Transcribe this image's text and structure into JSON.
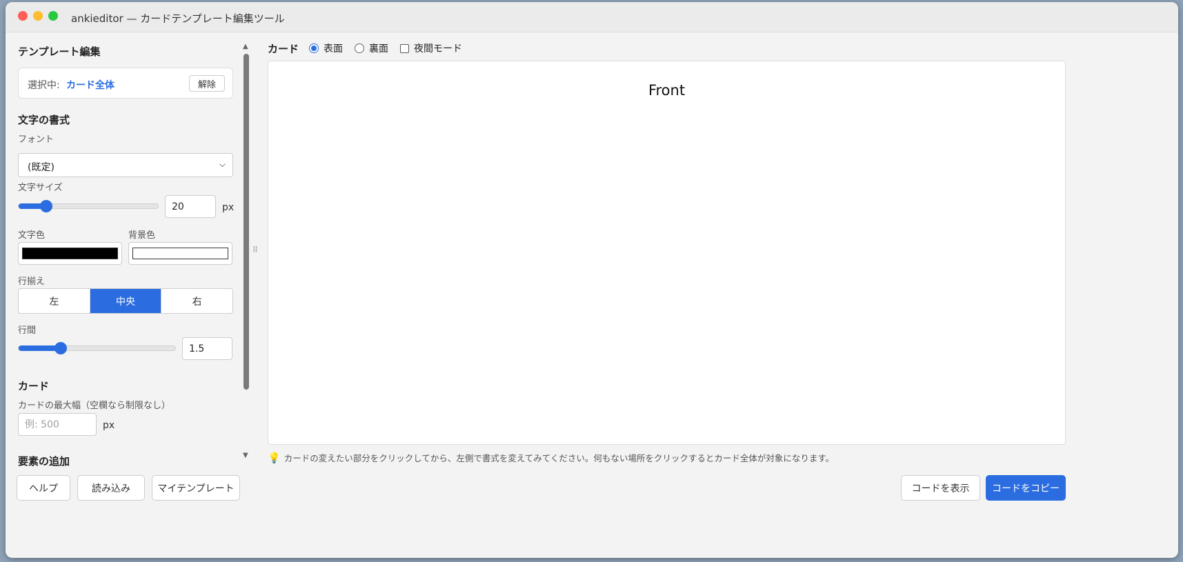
{
  "window": {
    "title": "ankieditor — カードテンプレート編集ツール"
  },
  "sidebar": {
    "template_title": "テンプレート編集",
    "selection": {
      "prefix": "選択中:",
      "value": "カード全体",
      "release_label": "解除"
    },
    "text_format": {
      "title": "文字の書式",
      "font_label": "フォント",
      "font_value": "(既定)",
      "size_label": "文字サイズ",
      "size_value": "20",
      "size_unit": "px",
      "size_slider_fraction": 0.2,
      "text_color_label": "文字色",
      "text_color": "#000000",
      "bg_color_label": "背景色",
      "bg_color": "#ffffff",
      "align_label": "行揃え",
      "align_options": [
        "左",
        "中央",
        "右"
      ],
      "align_selected": "中央",
      "line_height_label": "行間",
      "line_height_value": "1.5",
      "line_height_slider_fraction": 0.27
    },
    "card": {
      "title": "カード",
      "max_width_label": "カードの最大幅（空欄なら制限なし）",
      "max_width_placeholder": "例: 500",
      "max_width_unit": "px"
    },
    "add_element_title": "要素の追加"
  },
  "main": {
    "card_label": "カード",
    "side_options": [
      {
        "label": "表面",
        "checked": true
      },
      {
        "label": "裏面",
        "checked": false
      }
    ],
    "night_mode_label": "夜間モード",
    "night_mode_checked": false,
    "preview_text": "Front",
    "hint_text": "カードの変えたい部分をクリックしてから、左側で書式を変えてみてください。何もない場所をクリックするとカード全体が対象になります。"
  },
  "footer": {
    "help_label": "ヘルプ",
    "import_label": "読み込み",
    "my_templates_label": "マイテンプレート",
    "show_code_label": "コードを表示",
    "copy_code_label": "コードをコピー"
  },
  "colors": {
    "accent": "#2b6de0"
  },
  "icons": [
    "traffic-lights",
    "chevron-down-icon",
    "scroll-up-icon",
    "scroll-down-icon",
    "grip-icon",
    "lightbulb-icon"
  ]
}
